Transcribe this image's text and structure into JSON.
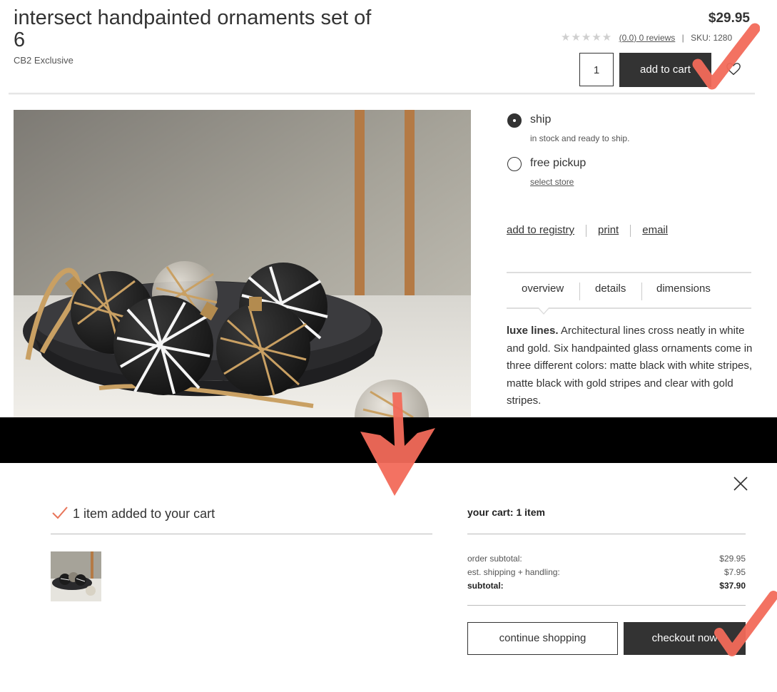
{
  "product": {
    "title": "intersect handpainted ornaments set of 6",
    "brand": "CB2 Exclusive",
    "price": "$29.95",
    "rating_text": "(0.0) 0 reviews",
    "sku": "SKU: 1280",
    "rating_stars": 0,
    "quantity": "1",
    "add_to_cart_label": "add to cart",
    "image_alt": "black, white and gold striped glass ornaments in a dark bowl"
  },
  "fulfillment": {
    "options": [
      {
        "label": "ship",
        "sub": "in stock and ready to ship.",
        "selected": true
      },
      {
        "label": "free pickup",
        "link": "select store",
        "selected": false
      }
    ]
  },
  "actions": {
    "registry": "add to registry",
    "print": "print",
    "email": "email"
  },
  "tabs": {
    "items": [
      "overview",
      "details",
      "dimensions"
    ],
    "active": "overview"
  },
  "overview": {
    "lead": "luxe lines.",
    "text": " Architectural lines cross neatly in white and gold. Six handpainted glass ornaments come in three different colors: matte black with white stripes, matte black with gold stripes and clear with gold stripes."
  },
  "cart_modal": {
    "added_message": "1 item added to your cart",
    "cart_title": "your cart: 1 item",
    "summary": [
      {
        "label": "order subtotal:",
        "value": "$29.95",
        "bold": false
      },
      {
        "label": "est. shipping + handling:",
        "value": "$7.95",
        "bold": false
      },
      {
        "label": "subtotal:",
        "value": "$37.90",
        "bold": true
      }
    ],
    "continue_label": "continue shopping",
    "checkout_label": "checkout now"
  },
  "colors": {
    "button_dark": "#333333",
    "annotation_red": "#f26a5a",
    "checkmark_accent": "#e8755a",
    "band": "#000000"
  },
  "icons": [
    "heart-icon",
    "close-icon",
    "check-icon",
    "star-icon",
    "radio-icon"
  ]
}
